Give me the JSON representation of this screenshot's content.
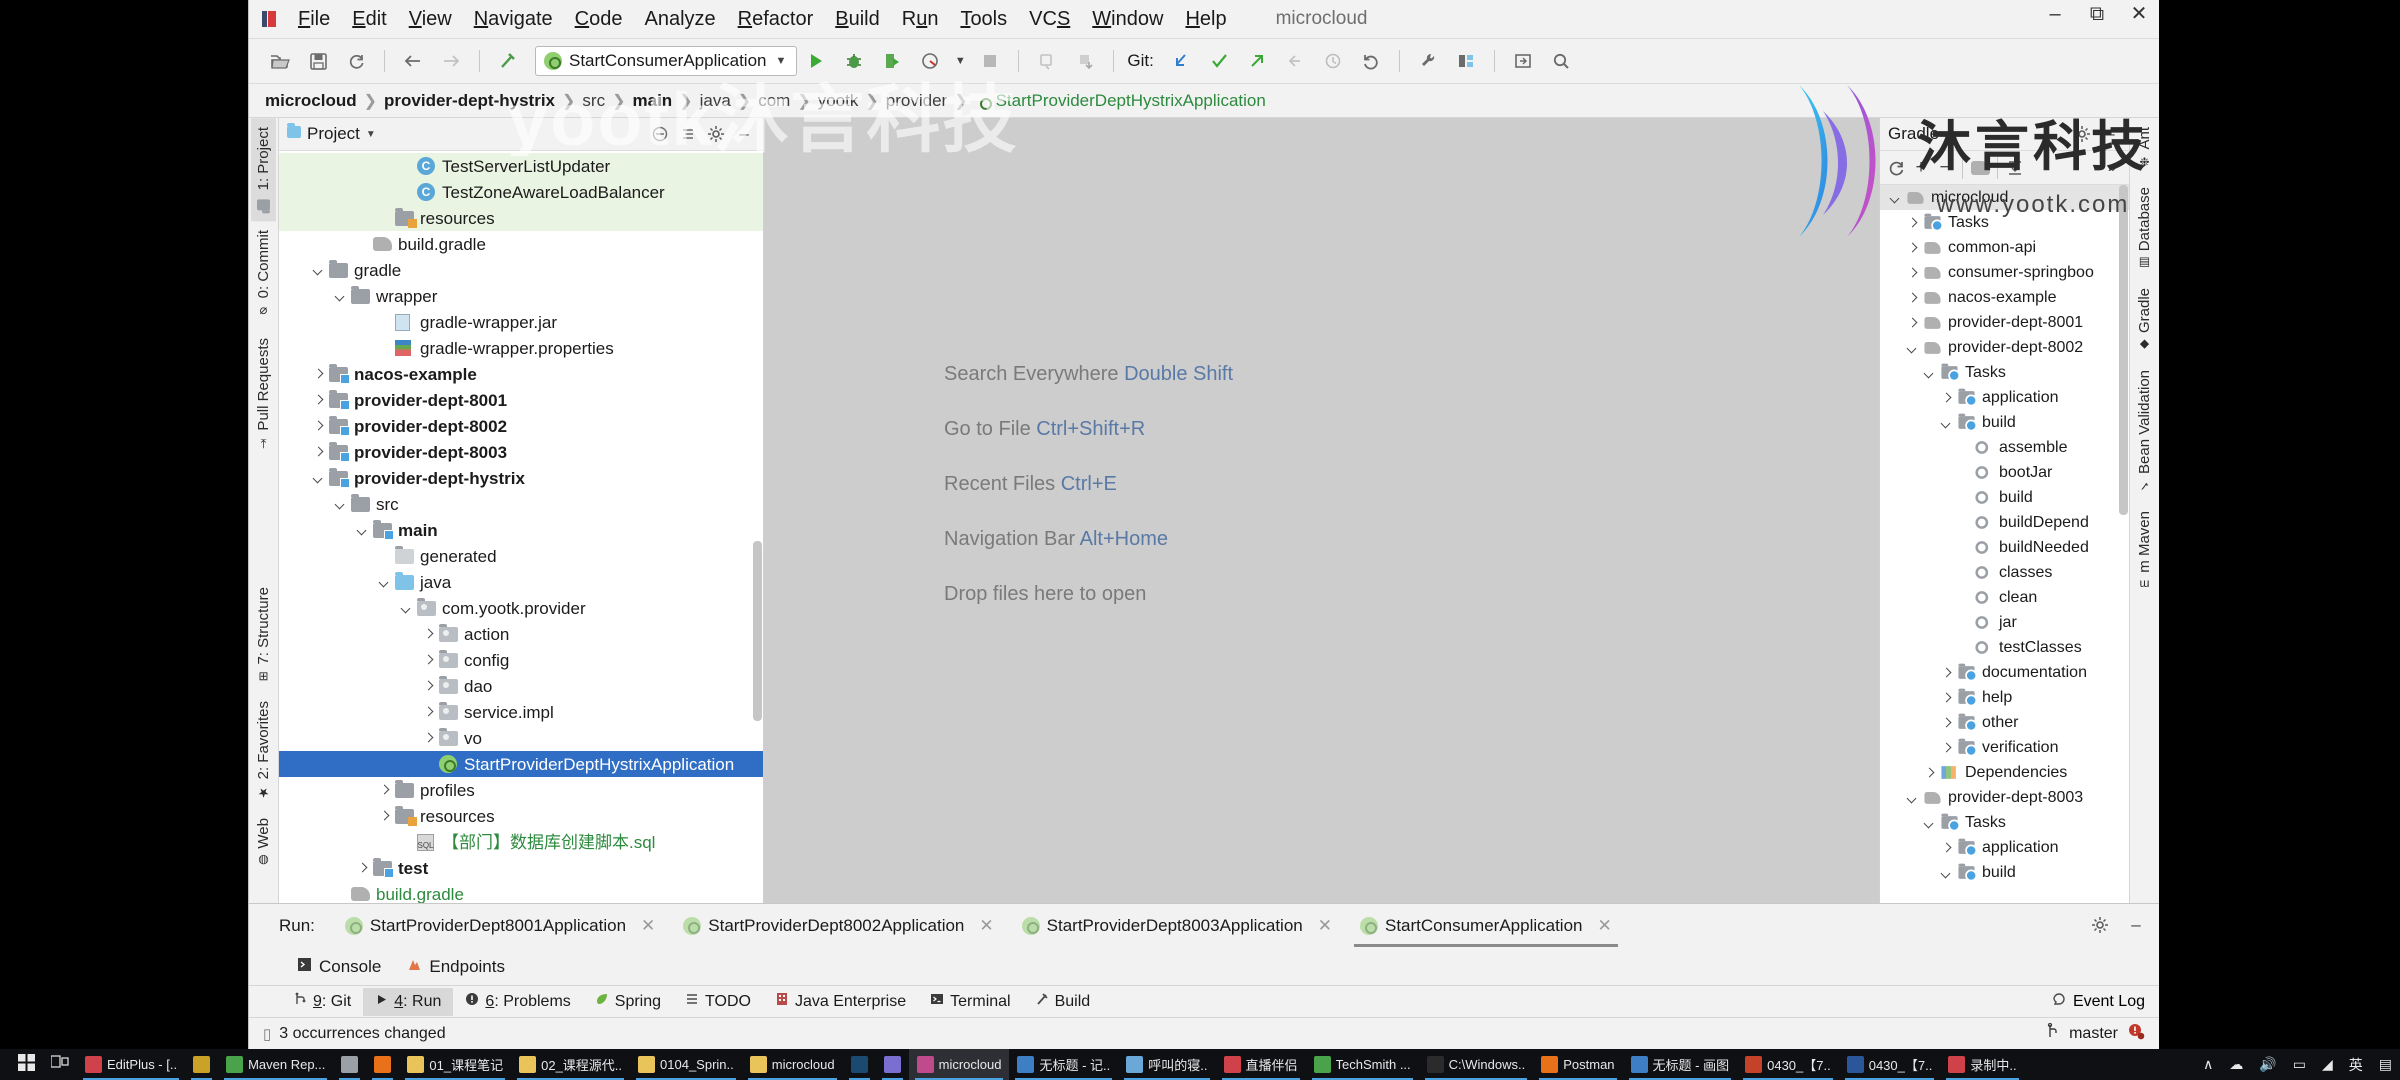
{
  "window": {
    "title": "microcloud",
    "controls": {
      "minimize": "–",
      "maximize": "⧉",
      "close": "✕"
    }
  },
  "menubar": {
    "items": [
      {
        "label": "File",
        "mnemonic": "F"
      },
      {
        "label": "Edit",
        "mnemonic": "E"
      },
      {
        "label": "View",
        "mnemonic": "V"
      },
      {
        "label": "Navigate",
        "mnemonic": "N"
      },
      {
        "label": "Code",
        "mnemonic": "C"
      },
      {
        "label": "Analyze",
        "mnemonic": ""
      },
      {
        "label": "Refactor",
        "mnemonic": "R"
      },
      {
        "label": "Build",
        "mnemonic": "B"
      },
      {
        "label": "Run",
        "mnemonic": "u"
      },
      {
        "label": "Tools",
        "mnemonic": "T"
      },
      {
        "label": "VCS",
        "mnemonic": "S"
      },
      {
        "label": "Window",
        "mnemonic": "W"
      },
      {
        "label": "Help",
        "mnemonic": "H"
      }
    ],
    "project_label": "microcloud"
  },
  "toolbar": {
    "open_icon": "open-folder-icon",
    "save_icon": "save-icon",
    "sync_icon": "sync-icon",
    "back_icon": "back-arrow-icon",
    "forward_icon": "forward-arrow-icon",
    "build_icon": "build-hammer-icon",
    "run_config": "StartConsumerApplication",
    "run_icon": "run-icon",
    "debug_icon": "debug-icon",
    "run_coverage_icon": "run-with-coverage-icon",
    "profile_icon": "profiler-icon",
    "stop_icon": "stop-icon",
    "git_label": "Git:",
    "git_update_icon": "git-update-project-icon",
    "git_commit_icon": "git-commit-icon",
    "git_push_icon": "git-push-icon",
    "git_rebase_icon": "git-rebase-icon",
    "git_history_icon": "git-history-icon",
    "git_rollback_icon": "git-rollback-icon",
    "settings_icon": "wrench-settings-icon",
    "project_structure_icon": "project-structure-icon",
    "select_in_icon": "select-in-icon",
    "search_icon": "search-icon"
  },
  "breadcrumbs": [
    {
      "label": "microcloud",
      "bold": true
    },
    {
      "label": "provider-dept-hystrix",
      "bold": true
    },
    {
      "label": "src",
      "bold": false
    },
    {
      "label": "main",
      "bold": true
    },
    {
      "label": "java",
      "bold": false
    },
    {
      "label": "com",
      "bold": false
    },
    {
      "label": "yootk",
      "bold": false
    },
    {
      "label": "provider",
      "bold": false
    },
    {
      "label": "StartProviderDeptHystrixApplication",
      "bold": false,
      "green": true
    }
  ],
  "left_strip": [
    {
      "label": "1: Project",
      "mnemonic": "1",
      "active": true,
      "icon": "project-icon"
    },
    {
      "label": "0: Commit",
      "mnemonic": "0",
      "active": false,
      "icon": "commit-icon"
    },
    {
      "label": "Pull Requests",
      "mnemonic": "",
      "active": false,
      "icon": "pull-request-icon"
    },
    {
      "label": "7: Structure",
      "mnemonic": "7",
      "active": false,
      "icon": "structure-icon"
    },
    {
      "label": "2: Favorites",
      "mnemonic": "2",
      "active": false,
      "icon": "star-icon"
    },
    {
      "label": "Web",
      "mnemonic": "",
      "active": false,
      "icon": "web-icon"
    }
  ],
  "right_strip": [
    {
      "label": "Ant",
      "icon": "ant-icon"
    },
    {
      "label": "Database",
      "icon": "database-icon"
    },
    {
      "label": "Gradle",
      "icon": "gradle-icon"
    },
    {
      "label": "Bean Validation",
      "icon": "bean-validation-icon"
    },
    {
      "label": "m Maven",
      "icon": "maven-icon"
    }
  ],
  "project_panel": {
    "title": "Project",
    "dropdown_icon": "chevron-down-icon",
    "collapse_icon": "collapse-all-icon",
    "options_icon": "options-icon",
    "settings_icon": "gear-icon",
    "hide_icon": "hide-icon",
    "tree": [
      {
        "label": "TestServerListUpdater",
        "depth": 5,
        "arrow": "none",
        "icon": "class-icon",
        "style": "highlight"
      },
      {
        "label": "TestZoneAwareLoadBalancer",
        "depth": 5,
        "arrow": "none",
        "icon": "class-icon",
        "style": "highlight"
      },
      {
        "label": "resources",
        "depth": 4,
        "arrow": "none",
        "icon": "resources-folder-icon",
        "style": "highlight"
      },
      {
        "label": "build.gradle",
        "depth": 3,
        "arrow": "none",
        "icon": "gradle-file-icon",
        "style": "normal"
      },
      {
        "label": "gradle",
        "depth": 1,
        "arrow": "down",
        "icon": "folder-icon",
        "style": "normal"
      },
      {
        "label": "wrapper",
        "depth": 2,
        "arrow": "down",
        "icon": "folder-icon",
        "style": "normal"
      },
      {
        "label": "gradle-wrapper.jar",
        "depth": 4,
        "arrow": "none",
        "icon": "jar-icon",
        "style": "normal"
      },
      {
        "label": "gradle-wrapper.properties",
        "depth": 4,
        "arrow": "none",
        "icon": "properties-icon",
        "style": "normal"
      },
      {
        "label": "nacos-example",
        "depth": 1,
        "arrow": "right",
        "icon": "module-folder-icon",
        "style": "bold"
      },
      {
        "label": "provider-dept-8001",
        "depth": 1,
        "arrow": "right",
        "icon": "module-folder-icon",
        "style": "bold"
      },
      {
        "label": "provider-dept-8002",
        "depth": 1,
        "arrow": "right",
        "icon": "module-folder-icon",
        "style": "bold"
      },
      {
        "label": "provider-dept-8003",
        "depth": 1,
        "arrow": "right",
        "icon": "module-folder-icon",
        "style": "bold"
      },
      {
        "label": "provider-dept-hystrix",
        "depth": 1,
        "arrow": "down",
        "icon": "module-folder-icon",
        "style": "bold"
      },
      {
        "label": "src",
        "depth": 2,
        "arrow": "down",
        "icon": "folder-icon",
        "style": "normal"
      },
      {
        "label": "main",
        "depth": 3,
        "arrow": "down",
        "icon": "module-folder-icon",
        "style": "bold"
      },
      {
        "label": "generated",
        "depth": 4,
        "arrow": "none",
        "icon": "generated-folder-icon",
        "style": "normal"
      },
      {
        "label": "java",
        "depth": 4,
        "arrow": "down",
        "icon": "source-folder-icon",
        "style": "normal"
      },
      {
        "label": "com.yootk.provider",
        "depth": 5,
        "arrow": "down",
        "icon": "package-icon",
        "style": "normal"
      },
      {
        "label": "action",
        "depth": 6,
        "arrow": "right",
        "icon": "package-icon",
        "style": "normal"
      },
      {
        "label": "config",
        "depth": 6,
        "arrow": "right",
        "icon": "package-icon",
        "style": "normal"
      },
      {
        "label": "dao",
        "depth": 6,
        "arrow": "right",
        "icon": "package-icon",
        "style": "normal"
      },
      {
        "label": "service.impl",
        "depth": 6,
        "arrow": "right",
        "icon": "package-icon",
        "style": "normal"
      },
      {
        "label": "vo",
        "depth": 6,
        "arrow": "right",
        "icon": "package-icon",
        "style": "normal"
      },
      {
        "label": "StartProviderDeptHystrixApplication",
        "depth": 6,
        "arrow": "none",
        "icon": "spring-class-icon",
        "style": "selected"
      },
      {
        "label": "profiles",
        "depth": 4,
        "arrow": "right",
        "icon": "folder-icon",
        "style": "normal"
      },
      {
        "label": "resources",
        "depth": 4,
        "arrow": "right",
        "icon": "resources-folder-icon",
        "style": "normal"
      },
      {
        "label": "【部门】数据库创建脚本.sql",
        "depth": 5,
        "arrow": "none",
        "icon": "sql-icon",
        "style": "green"
      },
      {
        "label": "test",
        "depth": 3,
        "arrow": "right",
        "icon": "module-folder-icon",
        "style": "bold"
      },
      {
        "label": "build.gradle",
        "depth": 2,
        "arrow": "none",
        "icon": "gradle-file-icon",
        "style": "green"
      }
    ]
  },
  "editor": {
    "hints": [
      {
        "text": "Search Everywhere ",
        "key": "Double Shift"
      },
      {
        "text": "Go to File ",
        "key": "Ctrl+Shift+R"
      },
      {
        "text": "Recent Files ",
        "key": "Ctrl+E"
      },
      {
        "text": "Navigation Bar ",
        "key": "Alt+Home"
      },
      {
        "text": "Drop files here to open",
        "key": ""
      }
    ]
  },
  "gradle_panel": {
    "title": "Gradle",
    "settings_icon": "gear-icon",
    "hide_icon": "hide-icon",
    "toolbar": [
      {
        "name": "refresh-icon",
        "glyph": "⟳"
      },
      {
        "name": "add-icon",
        "glyph": "+"
      },
      {
        "name": "remove-icon",
        "glyph": "−"
      },
      {
        "name": "execute-gradle-task-icon",
        "glyph": "gradle"
      },
      {
        "name": "expand-collapse-icon",
        "glyph": "≛"
      },
      {
        "name": "more-icon",
        "glyph": "»"
      }
    ],
    "tree": [
      {
        "label": "microcloud",
        "depth": 0,
        "arrow": "down",
        "icon": "gradle-icon",
        "style": "root"
      },
      {
        "label": "Tasks",
        "depth": 1,
        "arrow": "right",
        "icon": "tasks-folder-icon",
        "style": "normal"
      },
      {
        "label": "common-api",
        "depth": 1,
        "arrow": "right",
        "icon": "gradle-icon",
        "style": "normal"
      },
      {
        "label": "consumer-springboo",
        "depth": 1,
        "arrow": "right",
        "icon": "gradle-icon",
        "style": "normal"
      },
      {
        "label": "nacos-example",
        "depth": 1,
        "arrow": "right",
        "icon": "gradle-icon",
        "style": "normal"
      },
      {
        "label": "provider-dept-8001",
        "depth": 1,
        "arrow": "right",
        "icon": "gradle-icon",
        "style": "normal"
      },
      {
        "label": "provider-dept-8002",
        "depth": 1,
        "arrow": "down",
        "icon": "gradle-icon",
        "style": "normal"
      },
      {
        "label": "Tasks",
        "depth": 2,
        "arrow": "down",
        "icon": "tasks-folder-icon",
        "style": "normal"
      },
      {
        "label": "application",
        "depth": 3,
        "arrow": "right",
        "icon": "tasks-folder-icon",
        "style": "normal"
      },
      {
        "label": "build",
        "depth": 3,
        "arrow": "down",
        "icon": "tasks-folder-icon",
        "style": "normal"
      },
      {
        "label": "assemble",
        "depth": 4,
        "arrow": "none",
        "icon": "gradle-task-icon",
        "style": "normal"
      },
      {
        "label": "bootJar",
        "depth": 4,
        "arrow": "none",
        "icon": "gradle-task-icon",
        "style": "normal"
      },
      {
        "label": "build",
        "depth": 4,
        "arrow": "none",
        "icon": "gradle-task-icon",
        "style": "normal"
      },
      {
        "label": "buildDepend",
        "depth": 4,
        "arrow": "none",
        "icon": "gradle-task-icon",
        "style": "normal"
      },
      {
        "label": "buildNeeded",
        "depth": 4,
        "arrow": "none",
        "icon": "gradle-task-icon",
        "style": "normal"
      },
      {
        "label": "classes",
        "depth": 4,
        "arrow": "none",
        "icon": "gradle-task-icon",
        "style": "normal"
      },
      {
        "label": "clean",
        "depth": 4,
        "arrow": "none",
        "icon": "gradle-task-icon",
        "style": "normal"
      },
      {
        "label": "jar",
        "depth": 4,
        "arrow": "none",
        "icon": "gradle-task-icon",
        "style": "normal"
      },
      {
        "label": "testClasses",
        "depth": 4,
        "arrow": "none",
        "icon": "gradle-task-icon",
        "style": "normal"
      },
      {
        "label": "documentation",
        "depth": 3,
        "arrow": "right",
        "icon": "tasks-folder-icon",
        "style": "normal"
      },
      {
        "label": "help",
        "depth": 3,
        "arrow": "right",
        "icon": "tasks-folder-icon",
        "style": "normal"
      },
      {
        "label": "other",
        "depth": 3,
        "arrow": "right",
        "icon": "tasks-folder-icon",
        "style": "normal"
      },
      {
        "label": "verification",
        "depth": 3,
        "arrow": "right",
        "icon": "tasks-folder-icon",
        "style": "normal"
      },
      {
        "label": "Dependencies",
        "depth": 2,
        "arrow": "right",
        "icon": "dependencies-icon",
        "style": "normal"
      },
      {
        "label": "provider-dept-8003",
        "depth": 1,
        "arrow": "down",
        "icon": "gradle-icon",
        "style": "normal"
      },
      {
        "label": "Tasks",
        "depth": 2,
        "arrow": "down",
        "icon": "tasks-folder-icon",
        "style": "normal"
      },
      {
        "label": "application",
        "depth": 3,
        "arrow": "right",
        "icon": "tasks-folder-icon",
        "style": "normal"
      },
      {
        "label": "build",
        "depth": 3,
        "arrow": "down",
        "icon": "tasks-folder-icon",
        "style": "normal"
      }
    ]
  },
  "run_window": {
    "label": "Run:",
    "tabs": [
      {
        "label": "StartProviderDept8001Application",
        "active": false,
        "close": "✕"
      },
      {
        "label": "StartProviderDept8002Application",
        "active": false,
        "close": "✕"
      },
      {
        "label": "StartProviderDept8003Application",
        "active": false,
        "close": "✕"
      },
      {
        "label": "StartConsumerApplication",
        "active": true,
        "close": "✕"
      }
    ],
    "subtabs": [
      {
        "label": "Console",
        "icon": "console-icon"
      },
      {
        "label": "Endpoints",
        "icon": "endpoints-icon"
      }
    ],
    "settings_icon": "gear-icon",
    "hide_icon": "hide-icon"
  },
  "status_tabs": [
    {
      "label": "9: Git",
      "mnemonic": "9",
      "icon": "git-branch-icon",
      "active": false
    },
    {
      "label": "4: Run",
      "mnemonic": "4",
      "icon": "run-icon",
      "active": true
    },
    {
      "label": "6: Problems",
      "mnemonic": "6",
      "icon": "problems-icon",
      "active": false
    },
    {
      "label": "Spring",
      "mnemonic": "",
      "icon": "spring-leaf-icon",
      "active": false
    },
    {
      "label": "TODO",
      "mnemonic": "",
      "icon": "todo-icon",
      "active": false
    },
    {
      "label": "Java Enterprise",
      "mnemonic": "",
      "icon": "java-enterprise-icon",
      "active": false
    },
    {
      "label": "Terminal",
      "mnemonic": "",
      "icon": "terminal-icon",
      "active": false
    },
    {
      "label": "Build",
      "mnemonic": "",
      "icon": "build-icon",
      "active": false
    }
  ],
  "event_log": {
    "label": "Event Log",
    "icon": "event-log-icon"
  },
  "status_bar": {
    "message": "3 occurrences changed",
    "branch": "master",
    "branch_icon": "git-branch-icon",
    "notification_icon": "notification-error-icon"
  },
  "watermark": {
    "text": "yootk沐言科技",
    "brand": "沐言科技",
    "url": "www.yootk.com"
  },
  "taskbar": {
    "start_icon": "windows-start-icon",
    "task_view_icon": "task-view-icon",
    "items": [
      {
        "label": "EditPlus - [..",
        "icon": "editplus-icon",
        "color": "#d0424a",
        "running": true,
        "active": false
      },
      {
        "label": "",
        "icon": "sublime-icon",
        "color": "#c9a227",
        "running": true,
        "active": false
      },
      {
        "label": "Maven Rep...",
        "icon": "chrome-icon",
        "color": "#4aa34a",
        "running": true,
        "active": false
      },
      {
        "label": "",
        "icon": "app-icon",
        "color": "#9aa0a6",
        "running": true,
        "active": false
      },
      {
        "label": "",
        "icon": "firefox-icon",
        "color": "#e8711a",
        "running": true,
        "active": false
      },
      {
        "label": "01_课程笔记",
        "icon": "folder-icon",
        "color": "#e8c45a",
        "running": true,
        "active": false
      },
      {
        "label": "02_课程源代..",
        "icon": "folder-icon",
        "color": "#e8c45a",
        "running": true,
        "active": false
      },
      {
        "label": "0104_Sprin..",
        "icon": "folder-icon",
        "color": "#e8c45a",
        "running": true,
        "active": false
      },
      {
        "label": "microcloud",
        "icon": "folder-icon",
        "color": "#e8c45a",
        "running": true,
        "active": false
      },
      {
        "label": "",
        "icon": "photoshop-icon",
        "color": "#1b4a70",
        "running": true,
        "active": false
      },
      {
        "label": "",
        "icon": "app2-icon",
        "color": "#7a6fd0",
        "running": true,
        "active": false
      },
      {
        "label": "microcloud",
        "icon": "intellij-icon",
        "color": "#c04b8c",
        "running": true,
        "active": true
      },
      {
        "label": "无标题 - 记..",
        "icon": "notepad-icon",
        "color": "#3d7ec4",
        "running": true,
        "active": false
      },
      {
        "label": "呼叫的寝..",
        "icon": "app3-icon",
        "color": "#6aa8d8",
        "running": true,
        "active": false
      },
      {
        "label": "直播伴侣",
        "icon": "app4-icon",
        "color": "#d0424a",
        "running": true,
        "active": false
      },
      {
        "label": "TechSmith ...",
        "icon": "techsmith-icon",
        "color": "#4aa34a",
        "running": true,
        "active": false
      },
      {
        "label": "C:\\Windows..",
        "icon": "cmd-icon",
        "color": "#2b2b2b",
        "running": true,
        "active": false
      },
      {
        "label": "Postman",
        "icon": "postman-icon",
        "color": "#e8711a",
        "running": true,
        "active": false
      },
      {
        "label": "无标题 - 画图",
        "icon": "paint-icon",
        "color": "#3d7ec4",
        "running": true,
        "active": false
      },
      {
        "label": "0430_【7..",
        "icon": "powerpoint-icon",
        "color": "#c4422a",
        "running": true,
        "active": false
      },
      {
        "label": "0430_【7..",
        "icon": "word-icon",
        "color": "#2b579a",
        "running": true,
        "active": false
      },
      {
        "label": "录制中..",
        "icon": "record-icon",
        "color": "#d0424a",
        "running": true,
        "active": false
      }
    ],
    "tray": [
      "∧",
      "☁",
      "◀)",
      "⊡",
      "◢",
      "英",
      "▤"
    ]
  }
}
